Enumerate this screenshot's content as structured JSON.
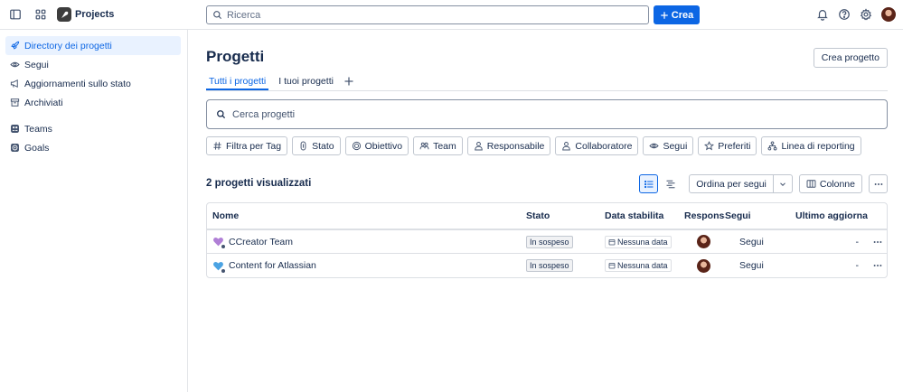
{
  "topbar": {
    "app_name": "Projects",
    "search_placeholder": "Ricerca",
    "create_label": "Crea"
  },
  "sidebar": {
    "items": [
      {
        "label": "Directory dei progetti",
        "icon": "rocket-icon",
        "active": true
      },
      {
        "label": "Segui",
        "icon": "eye-icon"
      },
      {
        "label": "Aggiornamenti sullo stato",
        "icon": "megaphone-icon"
      },
      {
        "label": "Archiviati",
        "icon": "archive-icon"
      }
    ],
    "secondary": [
      {
        "label": "Teams",
        "icon": "teams-icon"
      },
      {
        "label": "Goals",
        "icon": "goals-icon"
      }
    ]
  },
  "main": {
    "title": "Progetti",
    "create_project_label": "Crea progetto",
    "tabs": [
      {
        "label": "Tutti i progetti",
        "active": true
      },
      {
        "label": "I tuoi progetti"
      }
    ],
    "search_placeholder": "Cerca progetti",
    "filters": [
      {
        "label": "Filtra per Tag",
        "icon": "hash-icon"
      },
      {
        "label": "Stato",
        "icon": "status-icon"
      },
      {
        "label": "Obiettivo",
        "icon": "target-icon"
      },
      {
        "label": "Team",
        "icon": "team-icon"
      },
      {
        "label": "Responsabile",
        "icon": "person-icon"
      },
      {
        "label": "Collaboratore",
        "icon": "person-icon"
      },
      {
        "label": "Segui",
        "icon": "eye-icon"
      },
      {
        "label": "Preferiti",
        "icon": "star-icon"
      },
      {
        "label": "Linea di reporting",
        "icon": "hierarchy-icon"
      }
    ],
    "count_label": "2 progetti visualizzati",
    "sort_label": "Ordina per segui",
    "columns_label": "Colonne"
  },
  "table": {
    "headers": {
      "name": "Nome",
      "stato": "Stato",
      "data": "Data stabilita",
      "resp": "Responsabile",
      "segui": "Segui",
      "ultimo": "Ultimo aggiornamento"
    },
    "rows": [
      {
        "name": "CCreator Team",
        "color": "#b07fd6",
        "stato": "In sospeso",
        "data": "Nessuna data",
        "segui": "Segui",
        "ultimo": "-"
      },
      {
        "name": "Content for Atlassian",
        "color": "#4ba3e3",
        "stato": "In sospeso",
        "data": "Nessuna data",
        "segui": "Segui",
        "ultimo": "-"
      }
    ]
  },
  "colors": {
    "accent": "#0c66e4",
    "active_bg": "#e9f2ff"
  }
}
